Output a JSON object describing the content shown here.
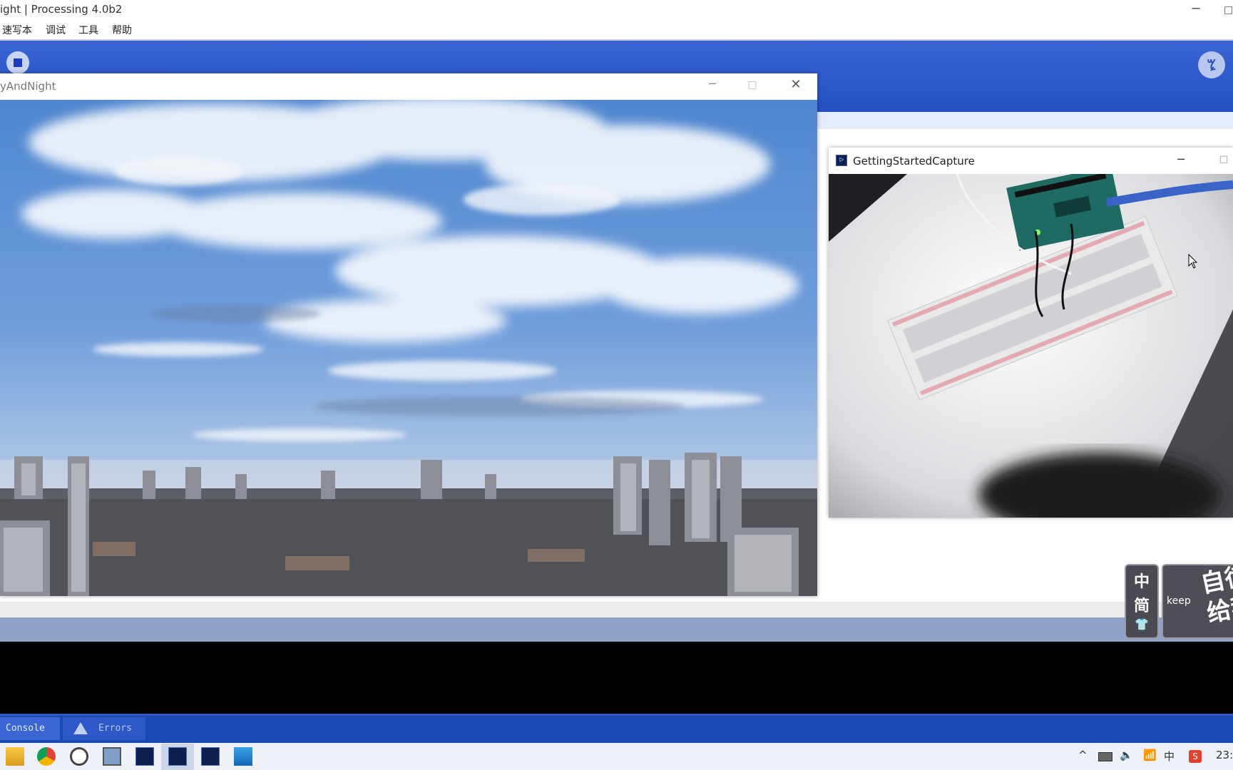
{
  "ide": {
    "title": "ight | Processing 4.0b2",
    "window_controls": {
      "minimize": "─",
      "maximize": "□"
    },
    "menu": [
      "速写本",
      "调试",
      "工具",
      "帮助"
    ],
    "mode_label": "ꔂ",
    "console_tab": "Console",
    "errors_tab": "Errors"
  },
  "sketch_window_1": {
    "title": "yAndNight",
    "controls": {
      "minimize": "─",
      "maximize": "□",
      "close": "✕"
    }
  },
  "sketch_window_2": {
    "title": "GettingStartedCapture",
    "icon_glyph": "ᐅ",
    "controls": {
      "minimize": "─",
      "maximize": "□"
    }
  },
  "ime": {
    "chars": [
      "中",
      "简",
      "👕"
    ],
    "ad_brand": "keep",
    "ad_text": "自律\n给我"
  },
  "taskbar": {
    "apps": [
      "file-explorer-icon",
      "chrome-icon",
      "obs-icon",
      "photos-icon",
      "processing-icon",
      "processing-icon-active",
      "processing-icon",
      "image-viewer-icon"
    ],
    "tray": {
      "chevron": "^",
      "ime_lang": "中",
      "clock": "23:"
    }
  },
  "colors": {
    "toolbar_blue": "#2f58cc",
    "console_bg": "#000000",
    "status_blue": "#8fa2c6"
  }
}
